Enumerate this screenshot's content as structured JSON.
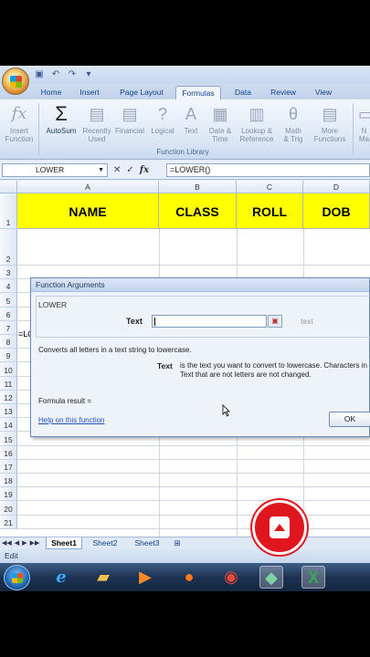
{
  "ribbon": {
    "tabs": [
      "Home",
      "Insert",
      "Page Layout",
      "Formulas",
      "Data",
      "Review",
      "View"
    ],
    "active_tab": "Formulas",
    "buttons": [
      {
        "line1": "Insert",
        "line2": "Function",
        "icon": "fx-icon"
      },
      {
        "line1": "AutoSum",
        "line2": "",
        "icon": "sigma-icon"
      },
      {
        "line1": "Recently",
        "line2": "Used",
        "icon": "book-icon"
      },
      {
        "line1": "Financial",
        "line2": "",
        "icon": "book-icon"
      },
      {
        "line1": "Logical",
        "line2": "",
        "icon": "question-book-icon"
      },
      {
        "line1": "Text",
        "line2": "",
        "icon": "text-book-icon"
      },
      {
        "line1": "Date &",
        "line2": "Time",
        "icon": "calendar-book-icon"
      },
      {
        "line1": "Lookup &",
        "line2": "Reference",
        "icon": "lookup-book-icon"
      },
      {
        "line1": "Math",
        "line2": "& Trig",
        "icon": "theta-book-icon"
      },
      {
        "line1": "More",
        "line2": "Functions",
        "icon": "more-book-icon"
      },
      {
        "line1": "N",
        "line2": "Ma",
        "icon": "name-manager-icon"
      }
    ],
    "group_label": "Function Library"
  },
  "formula_bar": {
    "name_box": "LOWER",
    "cancel": "✕",
    "enter": "✓",
    "fx": "fx",
    "value": "=LOWER()"
  },
  "sheet": {
    "columns": [
      "A",
      "B",
      "C",
      "D"
    ],
    "rows": [
      "1",
      "2",
      "3",
      "4",
      "5",
      "6",
      "7",
      "8",
      "9",
      "10",
      "11",
      "12",
      "13",
      "14",
      "15",
      "16",
      "17",
      "18",
      "19",
      "20",
      "21"
    ],
    "header_cells": [
      "NAME",
      "CLASS",
      "ROLL",
      "DOB"
    ],
    "header_fill": "#ffff00",
    "a2_value": "=LOWER()"
  },
  "dialog": {
    "title": "Function Arguments",
    "function_name": "LOWER",
    "arg_label": "Text",
    "arg_value": "",
    "arg_hint": "text",
    "description": "Converts all letters in a text string to lowercase.",
    "arg_name": "Text",
    "arg_description": "is the text you want to convert to lowercase. Characters in Text that are not letters are not changed.",
    "formula_result": "Formula result =",
    "help_link": "Help on this function",
    "ok": "OK"
  },
  "sheet_tabs": [
    "Sheet1",
    "Sheet2",
    "Sheet3"
  ],
  "active_sheet": "Sheet1",
  "status": "Edit",
  "taskbar": [
    "ie-icon",
    "folder-icon",
    "media-icon",
    "firefox-icon",
    "chrome-icon",
    "app-icon",
    "excel-icon"
  ],
  "record_color": "#e0161f"
}
